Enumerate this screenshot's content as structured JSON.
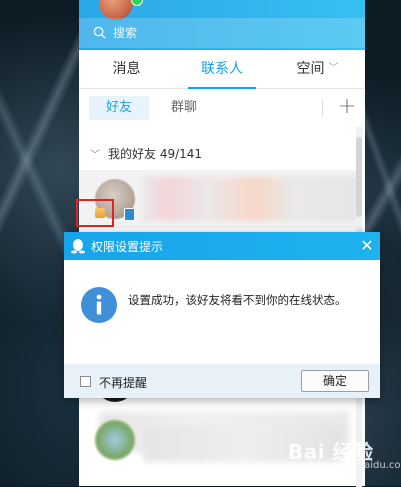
{
  "search": {
    "placeholder": "搜索"
  },
  "main_tabs": [
    {
      "label": "消息",
      "active": false
    },
    {
      "label": "联系人",
      "active": true
    },
    {
      "label": "空间",
      "active": false
    }
  ],
  "sub_tabs": {
    "friends": "好友",
    "groups": "群聊",
    "add": "+"
  },
  "group": {
    "label": "我的好友 49/141"
  },
  "dialog": {
    "title": "权限设置提示",
    "close": "✕",
    "message": "设置成功，该好友将看不到你的在线状态。",
    "checkbox_label": "不再提醒",
    "confirm": "确定"
  },
  "watermark": {
    "text": "Bai 经验",
    "sub": "jingyan.baidu.com"
  },
  "colors": {
    "accent": "#12a4e8",
    "title_bar": "#17a4ea",
    "highlight": "#e02323"
  }
}
